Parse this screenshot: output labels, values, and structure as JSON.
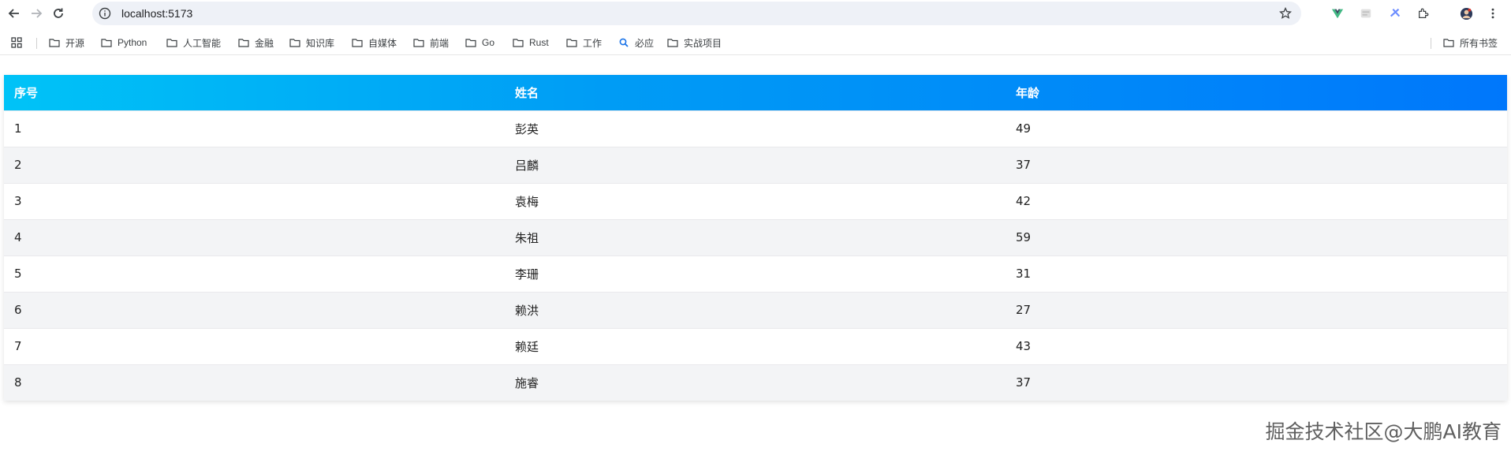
{
  "browser": {
    "url": "localhost:5173"
  },
  "bookmarks": [
    {
      "label": "开源",
      "icon": "folder-icon"
    },
    {
      "label": "Python",
      "icon": "folder-icon"
    },
    {
      "label": "人工智能",
      "icon": "folder-icon"
    },
    {
      "label": "金融",
      "icon": "folder-icon"
    },
    {
      "label": "知识库",
      "icon": "folder-icon"
    },
    {
      "label": "自媒体",
      "icon": "folder-icon"
    },
    {
      "label": "前端",
      "icon": "folder-icon"
    },
    {
      "label": "Go",
      "icon": "folder-icon"
    },
    {
      "label": "Rust",
      "icon": "folder-icon"
    },
    {
      "label": "工作",
      "icon": "folder-icon"
    },
    {
      "label": "必应",
      "icon": "search-icon"
    },
    {
      "label": "实战项目",
      "icon": "folder-icon"
    }
  ],
  "all_bookmarks_label": "所有书签",
  "table": {
    "headers": [
      "序号",
      "姓名",
      "年龄"
    ],
    "rows": [
      [
        "1",
        "彭英",
        "49"
      ],
      [
        "2",
        "吕麟",
        "37"
      ],
      [
        "3",
        "袁梅",
        "42"
      ],
      [
        "4",
        "朱祖",
        "59"
      ],
      [
        "5",
        "李珊",
        "31"
      ],
      [
        "6",
        "赖洪",
        "27"
      ],
      [
        "7",
        "赖廷",
        "43"
      ],
      [
        "8",
        "施睿",
        "37"
      ]
    ],
    "header_gradient": [
      "#00c3f7",
      "#0077fb"
    ]
  },
  "watermark": "掘金技术社区@大鹏AI教育"
}
